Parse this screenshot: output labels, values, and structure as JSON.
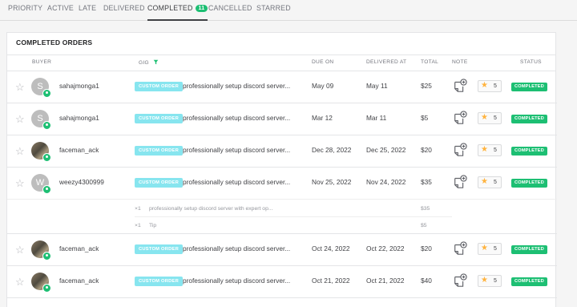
{
  "tabs": [
    {
      "label": "PRIORITY"
    },
    {
      "label": "ACTIVE"
    },
    {
      "label": "LATE"
    },
    {
      "label": "DELIVERED"
    },
    {
      "label": "COMPLETED",
      "count": "11"
    },
    {
      "label": "CANCELLED"
    },
    {
      "label": "STARRED"
    }
  ],
  "card_title": "COMPLETED ORDERS",
  "columns": {
    "buyer": "BUYER",
    "gig": "GIG",
    "due_on": "DUE ON",
    "delivered_at": "DELIVERED AT",
    "total": "TOTAL",
    "note": "NOTE",
    "status": "STATUS"
  },
  "colors": {
    "accent": "#1dbf73",
    "chip": "#87e5ef"
  },
  "orders": [
    {
      "buyer": "sahajmonga1",
      "avatar_letter": "S",
      "chip": "CUSTOM ORDER",
      "gig": "professionally setup discord server...",
      "due": "May 09",
      "delivered": "May 11",
      "total": "$25",
      "rating": "5",
      "status": "COMPLETED"
    },
    {
      "buyer": "sahajmonga1",
      "avatar_letter": "S",
      "chip": "CUSTOM ORDER",
      "gig": "professionally setup discord server...",
      "due": "Mar 12",
      "delivered": "Mar 11",
      "total": "$5",
      "rating": "5",
      "status": "COMPLETED"
    },
    {
      "buyer": "faceman_ack",
      "avatar_letter": "",
      "chip": "CUSTOM ORDER",
      "gig": "professionally setup discord server...",
      "due": "Dec 28, 2022",
      "delivered": "Dec 25, 2022",
      "total": "$20",
      "rating": "5",
      "status": "COMPLETED"
    },
    {
      "buyer": "weezy4300999",
      "avatar_letter": "W",
      "chip": "CUSTOM ORDER",
      "gig": "professionally setup discord server...",
      "due": "Nov 25, 2022",
      "delivered": "Nov 24, 2022",
      "total": "$35",
      "rating": "5",
      "status": "COMPLETED"
    },
    {
      "buyer": "faceman_ack",
      "avatar_letter": "",
      "chip": "CUSTOM ORDER",
      "gig": "professionally setup discord server...",
      "due": "Oct 24, 2022",
      "delivered": "Oct 22, 2022",
      "total": "$20",
      "rating": "5",
      "status": "COMPLETED"
    },
    {
      "buyer": "faceman_ack",
      "avatar_letter": "",
      "chip": "CUSTOM ORDER",
      "gig": "professionally setup discord server...",
      "due": "Oct 21, 2022",
      "delivered": "Oct 21, 2022",
      "total": "$40",
      "rating": "5",
      "status": "COMPLETED"
    }
  ],
  "breakdown": [
    {
      "qty": "×1",
      "desc": "professionally setup discord server with expert op...",
      "amount": "$35"
    },
    {
      "qty": "×1",
      "desc": "Tip",
      "amount": "$5"
    }
  ]
}
